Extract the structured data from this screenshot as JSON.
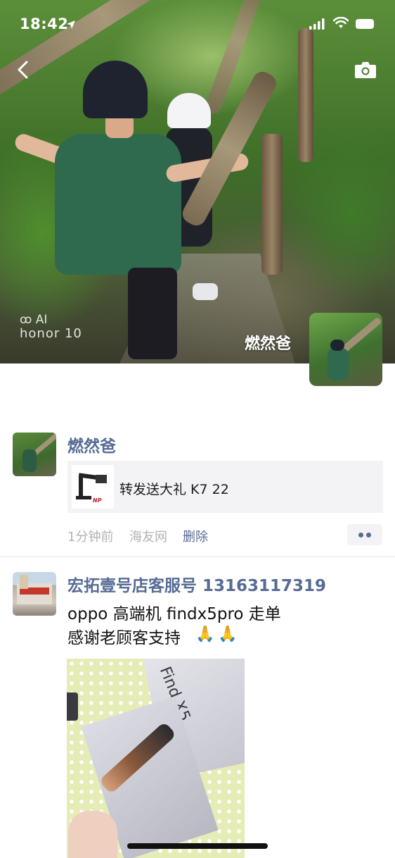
{
  "status_bar": {
    "time": "18:42",
    "icons": [
      "location-arrow-icon",
      "cellular-signal-icon",
      "wifi-icon",
      "battery-icon"
    ]
  },
  "header": {
    "back_icon": "chevron-left-icon",
    "camera_icon": "camera-icon",
    "cover_watermark_line1": "ꝏ AI",
    "cover_watermark_line2": "honor 10",
    "profile_name": "燃然爸"
  },
  "feed": {
    "posts": [
      {
        "author": "燃然爸",
        "link_card_title": "转发送大礼 K7 22",
        "link_thumb_logo": "NP",
        "time": "1分钟前",
        "source": "海友网",
        "delete_label": "删除"
      },
      {
        "author": "宏拓壹号店客服号 13163117319",
        "text_line1": "oppo 高端机 findx5pro 走单",
        "text_line2": "感谢老顾客支持",
        "emoji": [
          "🙏",
          "🙏"
        ],
        "photo_box_text": "Find X5"
      }
    ]
  },
  "colors": {
    "link_blue": "#576b95",
    "meta_gray": "#b2b2b2",
    "card_bg": "#f3f3f5"
  }
}
